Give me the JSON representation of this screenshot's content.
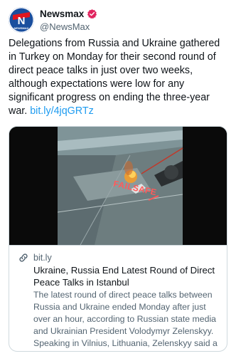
{
  "author": {
    "display_name": "Newsmax",
    "handle": "@NewsMax",
    "avatar_letter": "N",
    "avatar_wordmark": "NEWSMAX",
    "verified": true
  },
  "tweet": {
    "text": "Delegations from Russia and Ukraine gathered in Turkey on Monday for their second round of direct peace talks in just over two weeks, although expectations were low for any significant progress on ending the three-year war. ",
    "link_text": "bit.ly/4jqGRTz"
  },
  "card": {
    "image_overlay_text": "FAILSAFE",
    "domain": "bit.ly",
    "title": "Ukraine, Russia End Latest Round of Direct Peace Talks in Istanbul",
    "description": "The latest round of direct peace talks between Russia and Ukraine ended Monday after just over an hour, according to Russian state media and Ukrainian President Volodymyr Zelenskyy. Speaking in Vilnius, Lithuania, Zelenskyy said a new release of prisoners of war was being..."
  },
  "colors": {
    "brand_blue": "#1a4f9e",
    "brand_red": "#e0161e",
    "link": "#1d9bf0",
    "verified_badge": "#e0245e",
    "muted_text": "#536471"
  },
  "icons": [
    "avatar-logo",
    "verified-badge-icon",
    "link-icon"
  ]
}
